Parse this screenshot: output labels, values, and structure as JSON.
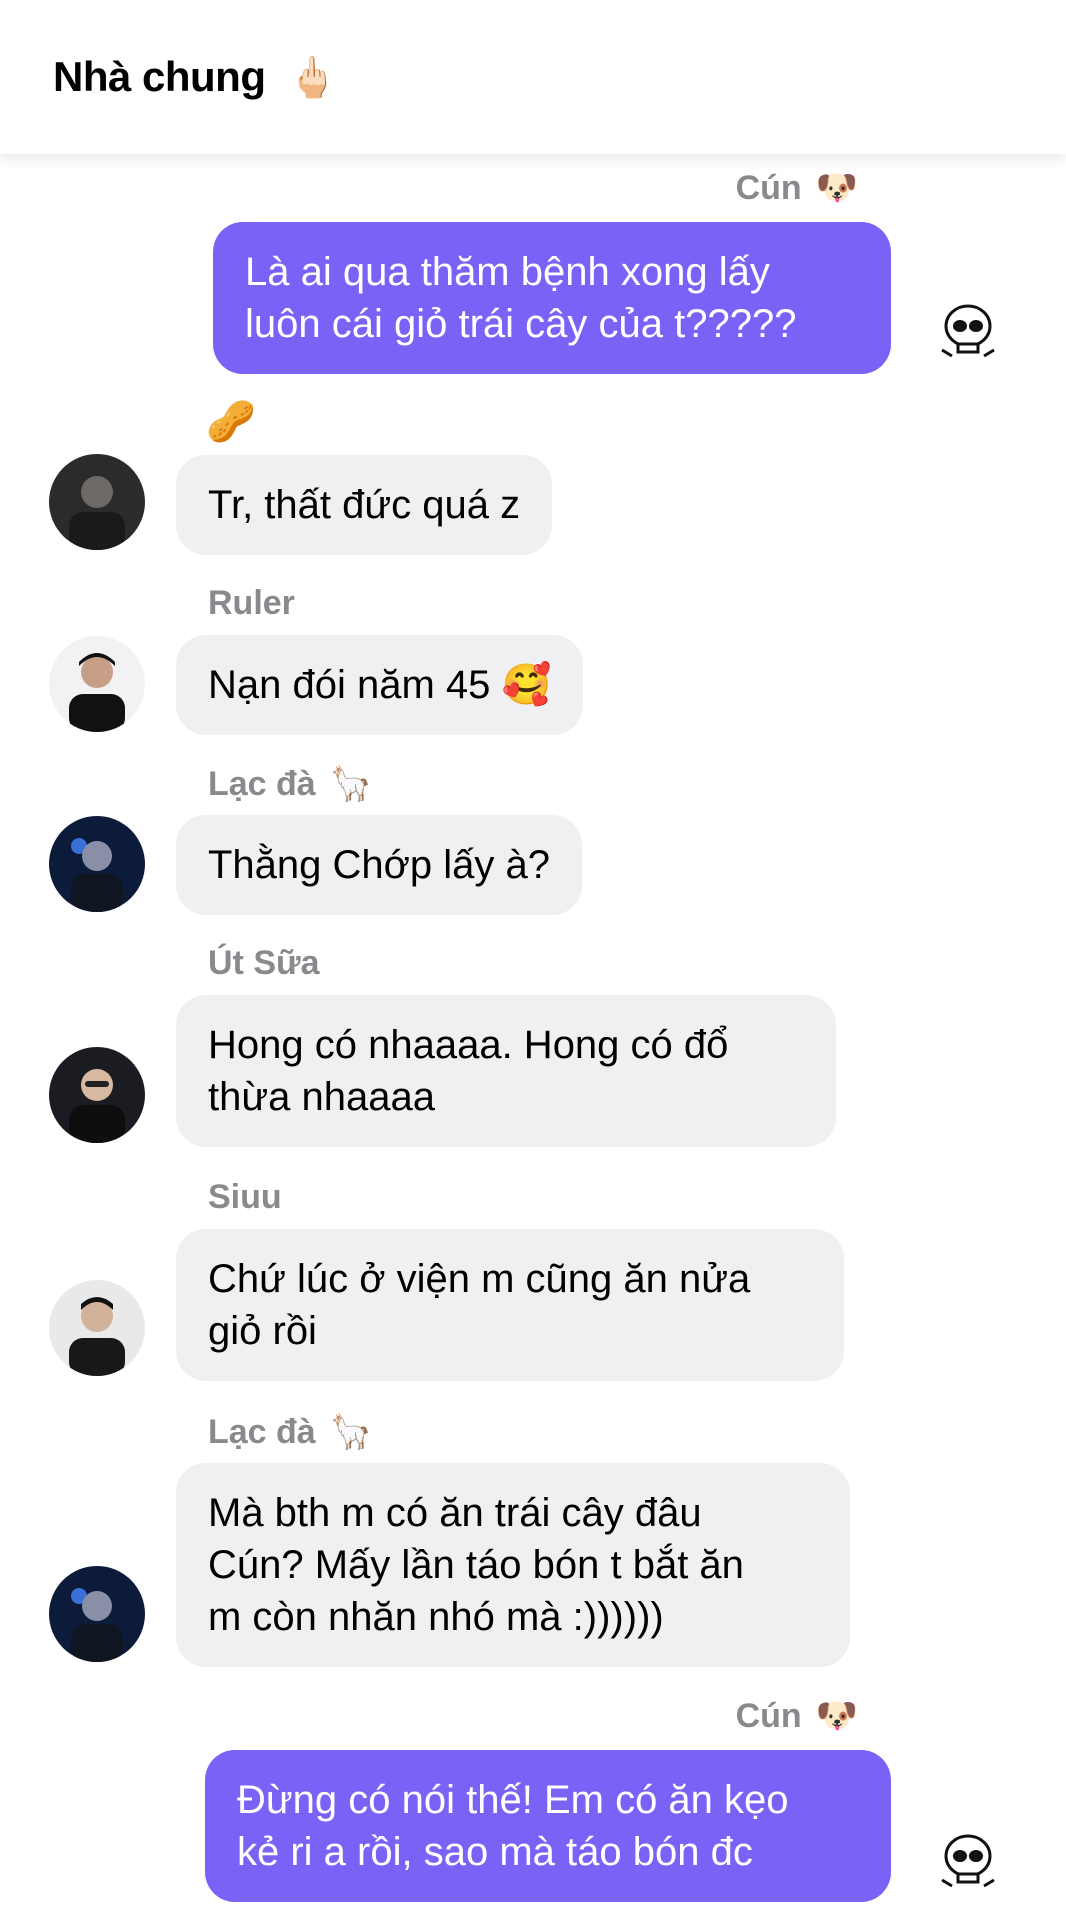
{
  "header": {
    "title": "Nhà chung",
    "emoji": "🖕🏻"
  },
  "messages": [
    {
      "sender": "Cún",
      "sender_emoji": "🐶",
      "text": "Là ai qua thăm bệnh xong lấy\nluôn cái giỏ trái cây của t?????"
    },
    {
      "reaction": "🥜",
      "text": "Tr, thất đức quá z"
    },
    {
      "sender": "Ruler",
      "text": "Nạn đói năm 45 🥰"
    },
    {
      "sender": "Lạc đà",
      "sender_emoji": "🦙",
      "text": "Thằng Chớp lấy à?"
    },
    {
      "sender": "Út Sữa",
      "text": "Hong có nhaaaa. Hong có đổ\nthừa nhaaaa"
    },
    {
      "sender": "Siuu",
      "text": "Chứ lúc ở viện m cũng ăn nửa\ngiỏ rồi"
    },
    {
      "sender": "Lạc đà",
      "sender_emoji": "🦙",
      "text": "Mà bth m có ăn trái cây đâu\nCún? Mấy lần táo bón t bắt ăn\nm còn nhăn nhó mà :))))))"
    },
    {
      "sender": "Cún",
      "sender_emoji": "🐶",
      "text": "Đừng có nói thế! Em có ăn kẹo\nkẻ ri a rồi, sao mà táo bón đc"
    }
  ],
  "colors": {
    "outgoing_bubble": "#7b61f5",
    "incoming_bubble": "#f0f0f2",
    "sender_name": "#8a8a8e"
  }
}
